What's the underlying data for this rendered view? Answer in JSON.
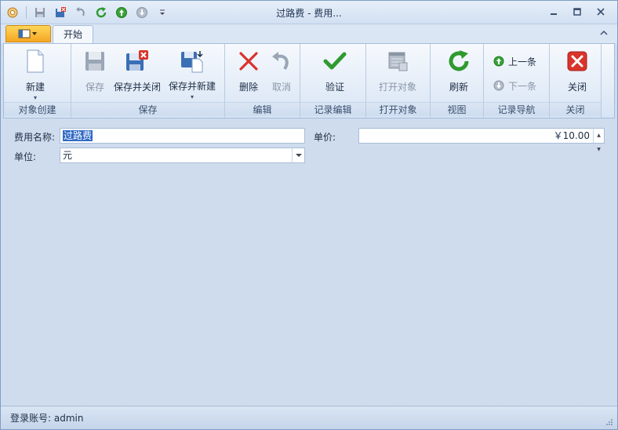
{
  "window": {
    "title": "过路费 - 费用..."
  },
  "tabs": {
    "home": "开始"
  },
  "ribbon": {
    "groups": {
      "create": "对象创建",
      "save": "保存",
      "edit": "编辑",
      "record_edit": "记录编辑",
      "open_object": "打开对象",
      "view": "视图",
      "record_nav": "记录导航",
      "close": "关闭"
    },
    "buttons": {
      "new": "新建",
      "save": "保存",
      "save_close": "保存并关闭",
      "save_new": "保存并新建",
      "delete": "删除",
      "cancel": "取消",
      "validate": "验证",
      "open_object": "打开对象",
      "refresh": "刷新",
      "prev": "上一条",
      "next": "下一条",
      "close": "关闭"
    }
  },
  "form": {
    "fee_name_label": "费用名称:",
    "fee_name_value": "过路费",
    "unit_label": "单位:",
    "unit_value": "元",
    "price_label": "单价:",
    "price_value": "￥10.00"
  },
  "status": {
    "text": "登录账号: admin"
  },
  "colors": {
    "accent": "#316ac5",
    "app_button": "#f5a623",
    "delete_red": "#d9342b",
    "validate_green": "#2f9a2f",
    "close_red": "#d9342b"
  }
}
